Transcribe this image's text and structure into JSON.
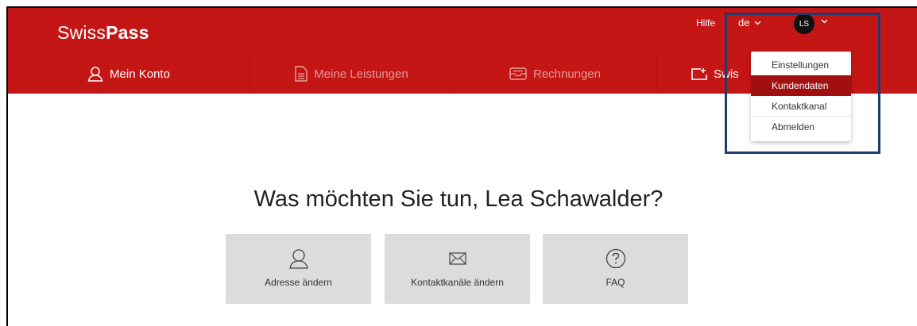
{
  "brand": {
    "light": "Swiss",
    "bold": "Pass"
  },
  "header": {
    "help": "Hilfe",
    "language": "de",
    "avatar_initials": "LS"
  },
  "nav": {
    "items": [
      {
        "label": "Mein Konto",
        "icon": "user-icon"
      },
      {
        "label": "Meine Leistungen",
        "icon": "document-icon"
      },
      {
        "label": "Rechnungen",
        "icon": "inbox-icon"
      },
      {
        "label": "Swis",
        "icon": "add-card-icon"
      }
    ]
  },
  "user_menu": {
    "items": [
      {
        "label": "Einstellungen"
      },
      {
        "label": "Kundendaten",
        "active": true
      },
      {
        "label": "Kontaktkanal"
      },
      {
        "label": "Abmelden"
      }
    ]
  },
  "main": {
    "greeting": "Was möchten Sie tun, Lea Schawalder?",
    "cards": [
      {
        "label": "Adresse ändern",
        "icon": "user-icon"
      },
      {
        "label": "Kontaktkanäle ändern",
        "icon": "envelope-icon"
      },
      {
        "label": "FAQ",
        "icon": "question-icon"
      }
    ]
  },
  "colors": {
    "brand_red": "#c51616",
    "active_red": "#a01010",
    "highlight_border": "#1f3a6e",
    "card_bg": "#dcdcdc"
  }
}
